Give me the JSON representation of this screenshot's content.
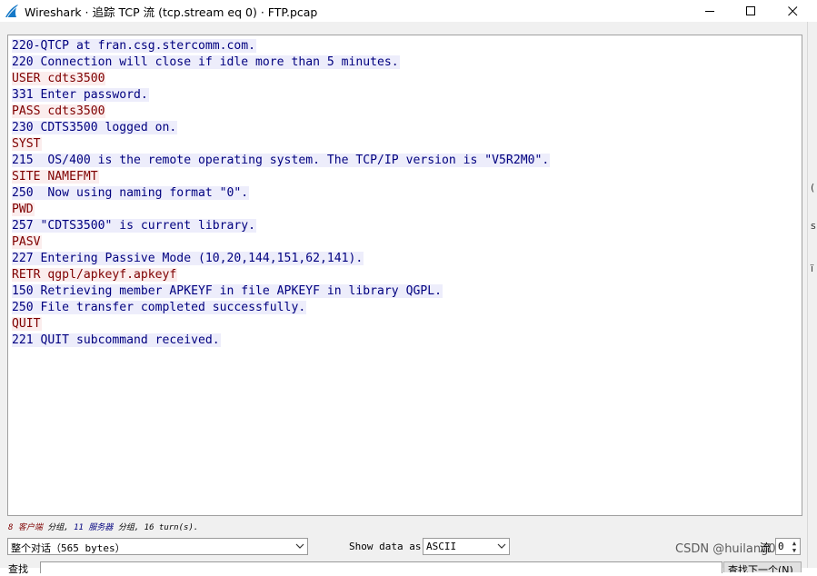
{
  "window": {
    "title": "Wireshark · 追踪 TCP 流 (tcp.stream eq 0) · FTP.pcap",
    "minimize_icon": "minimize-icon",
    "maximize_icon": "maximize-icon",
    "close_icon": "close-icon"
  },
  "stream_lines": [
    {
      "dir": "server",
      "text": "220-QTCP at fran.csg.stercomm.com."
    },
    {
      "dir": "server",
      "text": "220 Connection will close if idle more than 5 minutes."
    },
    {
      "dir": "client",
      "text": "USER cdts3500"
    },
    {
      "dir": "server",
      "text": "331 Enter password."
    },
    {
      "dir": "client",
      "text": "PASS cdts3500"
    },
    {
      "dir": "server",
      "text": "230 CDTS3500 logged on."
    },
    {
      "dir": "client",
      "text": "SYST"
    },
    {
      "dir": "server",
      "text": "215  OS/400 is the remote operating system. The TCP/IP version is \"V5R2M0\"."
    },
    {
      "dir": "client",
      "text": "SITE NAMEFMT"
    },
    {
      "dir": "server",
      "text": "250  Now using naming format \"0\"."
    },
    {
      "dir": "client",
      "text": "PWD"
    },
    {
      "dir": "server",
      "text": "257 \"CDTS3500\" is current library."
    },
    {
      "dir": "client",
      "text": "PASV"
    },
    {
      "dir": "server",
      "text": "227 Entering Passive Mode (10,20,144,151,62,141)."
    },
    {
      "dir": "client",
      "text": "RETR qgpl/apkeyf.apkeyf"
    },
    {
      "dir": "server",
      "text": "150 Retrieving member APKEYF in file APKEYF in library QGPL."
    },
    {
      "dir": "server",
      "text": "250 File transfer completed successfully."
    },
    {
      "dir": "client",
      "text": "QUIT"
    },
    {
      "dir": "server",
      "text": "221 QUIT subcommand received."
    }
  ],
  "stats": {
    "client_count": "8",
    "client_label": "客户端",
    "client_suffix": "分组,",
    "server_count": "11",
    "server_label": "服务器",
    "server_suffix": "分组,",
    "turns": "16 turn(s)."
  },
  "controls": {
    "conversation_value": "整个对话（565 bytes）",
    "show_label": "Show data as",
    "format_value": "ASCII",
    "stream_label": "流",
    "stream_value": "0",
    "find_label": "查找",
    "find_button_label": "查找下一个(N)"
  },
  "watermark": "CSDN @huilang041",
  "right_strip_chars": [
    "(",
    "s",
    "ï"
  ],
  "colors": {
    "client_fg": "#7f0000",
    "client_bg": "#fbeded",
    "server_fg": "#00007f",
    "server_bg": "#ededfb"
  }
}
